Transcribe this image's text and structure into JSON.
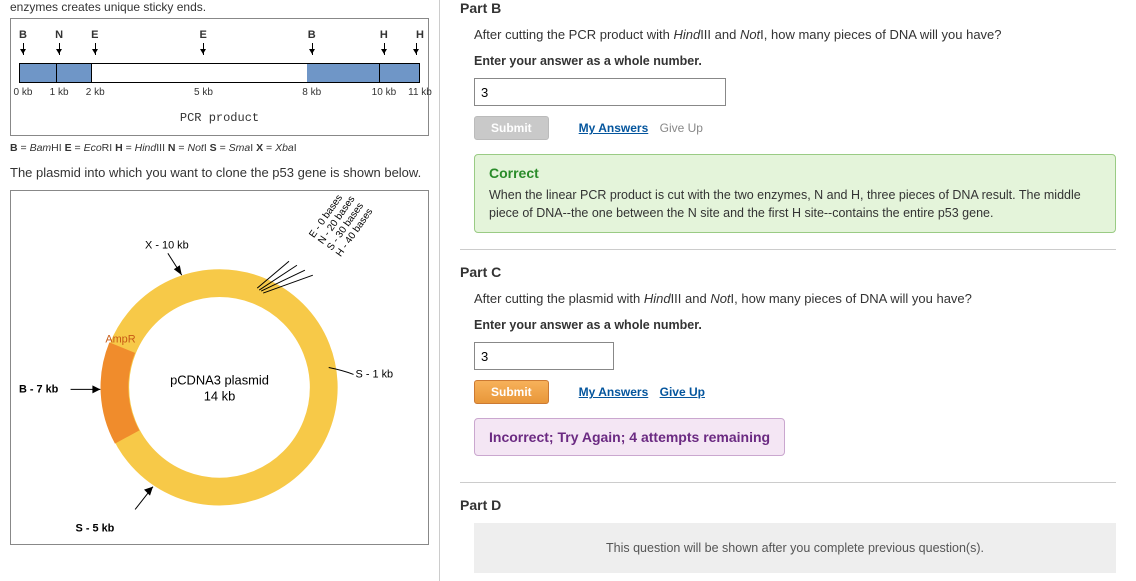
{
  "left": {
    "intro": "enzymes creates unique sticky ends.",
    "pcr_letters": [
      "B",
      "N",
      "E",
      "E",
      "B",
      "H",
      "H"
    ],
    "kb_labels": [
      "0 kb",
      "1 kb",
      "2 kb",
      "5 kb",
      "8 kb",
      "10 kb",
      "11 kb"
    ],
    "pcr_caption": "PCR product",
    "enzyme_key_html": "B = BamHI E = EcoRI H = HindIII N = NotI S = SmaI X = XbaI",
    "plasmid_intro": "The plasmid into which you want to clone the p53 gene is shown below.",
    "plasmid": {
      "title_line1": "pCDNA3 plasmid",
      "title_line2": "14 kb",
      "ampR": "AmpR",
      "x_label": "X - 10 kb",
      "s_label": "S - 1 kb",
      "b_label": "B - 7 kb",
      "s5_label": "S - 5 kb",
      "mcs": [
        "E - 0 bases",
        "N - 20 bases",
        "S - 30 bases",
        "H - 40 bases"
      ]
    }
  },
  "partB": {
    "header": "Part B",
    "desc": "After cutting the PCR product with HindIII and NotI, how many pieces of DNA will you have?",
    "instr": "Enter your answer as a whole number.",
    "value": "3",
    "submit": "Submit",
    "myAnswers": "My Answers",
    "giveUp": "Give Up",
    "correct_hdr": "Correct",
    "correct_body": "When the linear PCR product is cut with the two enzymes, N and H, three pieces of DNA result. The middle piece of DNA--the one between the N site and the first H site--contains the entire p53 gene."
  },
  "partC": {
    "header": "Part C",
    "desc": "After cutting the plasmid with HindIII and NotI, how many pieces of DNA will you have?",
    "instr": "Enter your answer as a whole number.",
    "value": "3",
    "submit": "Submit",
    "myAnswers": "My Answers",
    "giveUp": "Give Up",
    "incorrect_hdr": "Incorrect; Try Again; 4 attempts remaining"
  },
  "partD": {
    "header": "Part D",
    "body": "This question will be shown after you complete previous question(s)."
  }
}
